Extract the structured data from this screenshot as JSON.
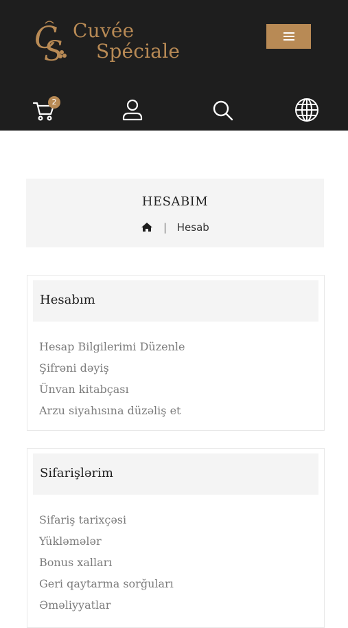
{
  "brand": {
    "line1": "Cuvée",
    "line2": "Spéciale",
    "monogram": "CS",
    "color": "#b88a55"
  },
  "header": {
    "menu_icon": "hamburger-icon",
    "cart_count": "2",
    "icons": [
      "cart-icon",
      "user-icon",
      "search-icon",
      "globe-icon"
    ]
  },
  "page": {
    "title": "HESABIM",
    "breadcrumb": {
      "home_icon": "home-icon",
      "separator": "|",
      "current": "Hesab"
    }
  },
  "account_section": {
    "title": "Hesabım",
    "links": [
      "Hesap Bilgilerimi Düzenle",
      "Şifrəni dəyiş",
      "Ünvan kitabçası",
      "Arzu siyahısına düzəliş et"
    ]
  },
  "orders_section": {
    "title": "Sifarişlərim",
    "links": [
      "Sifariş tarixçəsi",
      "Yükləmələr",
      "Bonus xalları",
      "Geri qaytarma sorğuları",
      "Əməliyyatlar"
    ]
  }
}
